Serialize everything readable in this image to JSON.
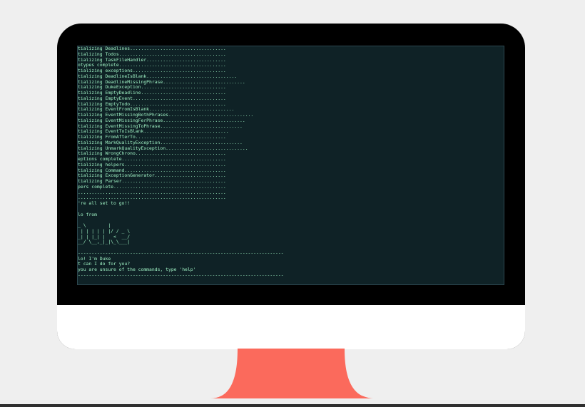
{
  "colors": {
    "background": "#efefef",
    "bezel": "#000000",
    "chin": "#ffffff",
    "screen": "#0f2226",
    "terminal_text": "#9ff2c4",
    "stand": "#fb6a5c"
  },
  "terminal": {
    "lines": [
      "tializing Deadlines...................................",
      "tializing Todos.......................................",
      "tializing TaskFileHandler.............................",
      "otypes complete.......................................",
      "tializing exceptions..................................",
      "tializing DeadlineIsBlank.................................",
      "tializing DeadlineMissingPhrase..............................",
      "tializing DukeException...............................",
      "tializing EmptyDeadline...............................",
      "tializing EmptyEvent..................................",
      "tializing EmptyTodo...................................",
      "tializing EventFromIsBlank...............................",
      "tializing EventMissingBothPhrases...............................",
      "tializing EventMissingFerPhrase..............................",
      "tializing EventMissingToPhrase..............................",
      "tializing EventToIsBlank...............................",
      "tializing FromAfterTo.................................",
      "tializing MarkQualityException..............................",
      "tializing UnmarkQualityException..............................",
      "tializing WrongChrono.................................",
      "eptions complete......................................",
      "tializing helpers.....................................",
      "tializing Command.....................................",
      "tializing ExceptionGenerator..........................",
      "tializing Parser......................................",
      "pers complete.........................................",
      "......................................................",
      "......................................................",
      "'re all set to go!!",
      "",
      "lo from",
      "",
      "_ \\        |",
      " | | | | | |/ / _ \\",
      "_| | |_| |   <  __/",
      "__/ \\__,_|_|\\_\\___|",
      "",
      "---------------------------------------------------------------------------",
      "lo! I'm Duke",
      "t can I do for you?",
      "you are unsure of the commands, type 'help'",
      "---------------------------------------------------------------------------"
    ]
  }
}
